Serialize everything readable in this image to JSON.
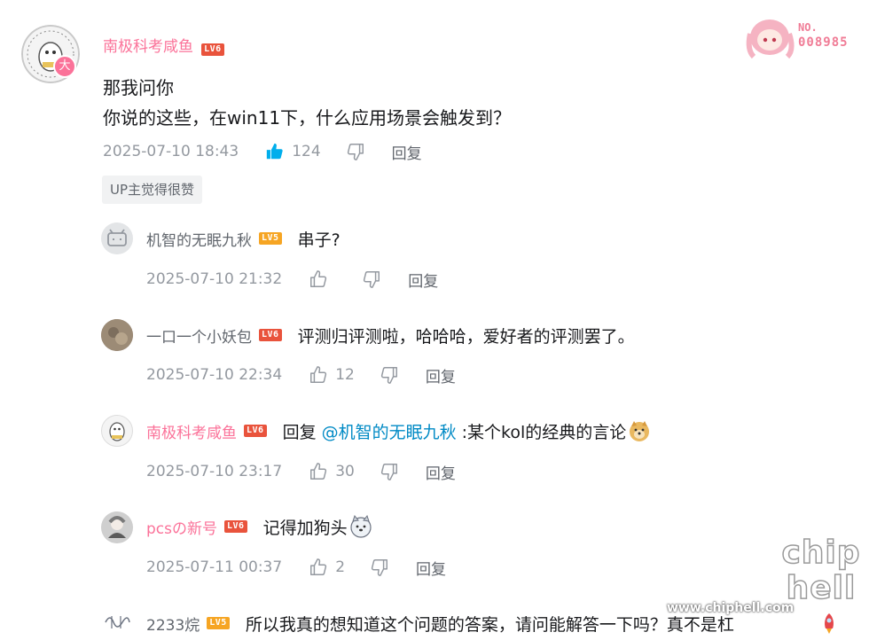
{
  "main_comment": {
    "author": "南极科考咸鱼",
    "level": "LV6",
    "avatar_badge": "大",
    "lines": [
      "那我问你",
      "你说的这些，在win11下，什么应用场景会触发到？"
    ],
    "time": "2025-07-10 18:43",
    "likes": "124",
    "reply_label": "回复",
    "up_badge": "UP主觉得很赞",
    "decor_number_prefix": "NO.",
    "decor_number": "008985"
  },
  "replies": [
    {
      "author": "机智的无眠九秋",
      "level": "LV5",
      "text": "串子?",
      "time": "2025-07-10 21:32",
      "likes": "",
      "reply_label": "回复"
    },
    {
      "author": "一口一个小妖包",
      "level": "LV6",
      "text": "评测归评测啦，哈哈哈，爱好者的评测罢了。",
      "time": "2025-07-10 22:34",
      "likes": "12",
      "reply_label": "回复"
    },
    {
      "author": "南极科考咸鱼",
      "level": "LV6",
      "reply_prefix": "回复",
      "mention": "@机智的无眠九秋",
      "text": ":某个kol的经典的言论",
      "time": "2025-07-10 23:17",
      "likes": "30",
      "reply_label": "回复"
    },
    {
      "author": "pcsの新号",
      "level": "LV6",
      "text": "记得加狗头",
      "time": "2025-07-11 00:37",
      "likes": "2",
      "reply_label": "回复"
    },
    {
      "author": "2233烷",
      "level": "LV5",
      "text": "所以我真的想知道这个问题的答案，请问能解答一下吗？真不是杠"
    }
  ],
  "watermark": {
    "brand": "chip hell",
    "url": "www.chiphell.com"
  },
  "colors": {
    "vip_pink": "#fb7299",
    "level6": "#e9533c",
    "level5": "#f6a523",
    "liked_blue": "#00aeec",
    "mention": "#008ac5"
  }
}
